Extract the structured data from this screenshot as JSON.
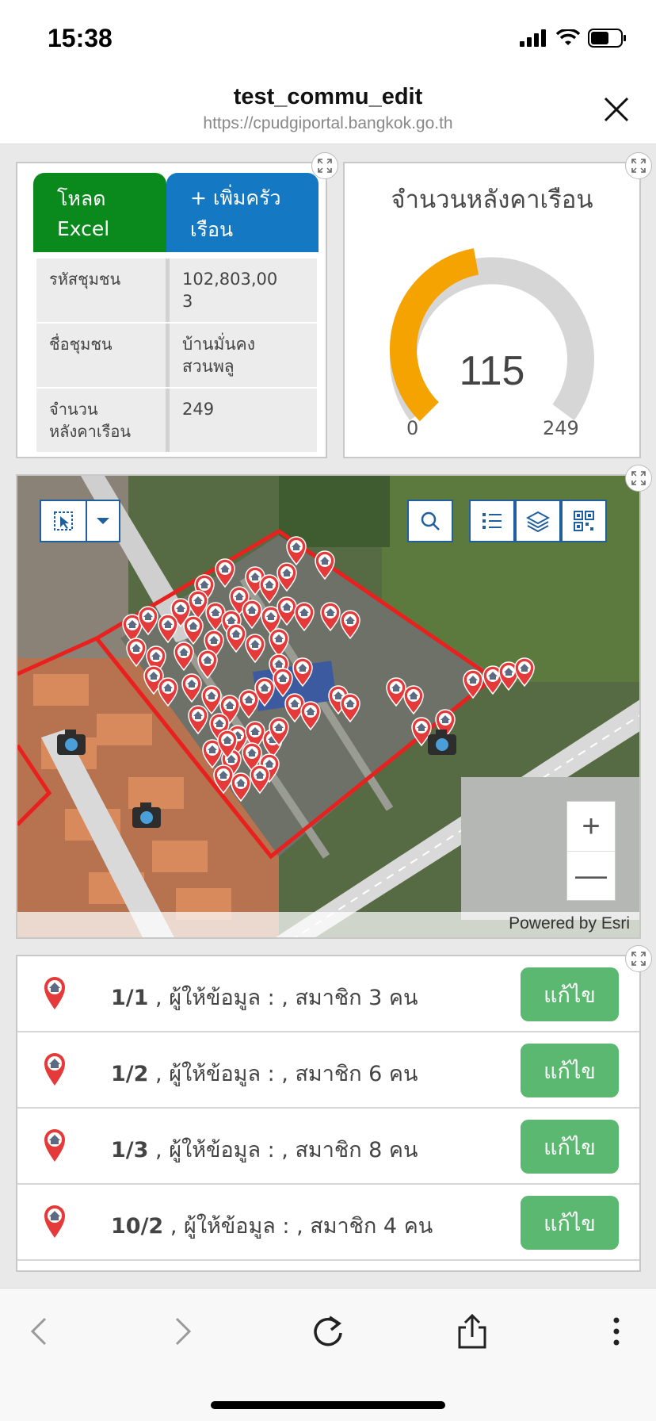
{
  "status_bar": {
    "time": "15:38"
  },
  "browser": {
    "title": "test_commu_edit",
    "url": "https://cpudgiportal.bangkok.go.th"
  },
  "info_card": {
    "excel_button": {
      "line1": "โหลด",
      "line2": "Excel"
    },
    "add_button": {
      "line1": "+ เพิ่มครัว",
      "line2": "เรือน"
    },
    "rows": [
      {
        "key": "รหัสชุมชน",
        "value": "102,803,00\n3"
      },
      {
        "key": "ชื่อชุมชน",
        "value": "บ้านมั่นคง\nสวนพลู"
      },
      {
        "key": "จำนวน\nหลังคาเรือน",
        "value": "249"
      }
    ]
  },
  "gauge": {
    "title": "จำนวนหลังคาเรือน",
    "value": "115",
    "min": "0",
    "max": "249",
    "fill_color": "#f5a300",
    "track_color": "#d6d6d6"
  },
  "map": {
    "attribution": "Powered by Esri",
    "zoom_in": "+",
    "zoom_out": "—",
    "boundary_color": "#e8211f",
    "marker_color": "#e53a3a"
  },
  "household_list": {
    "items": [
      {
        "id": "1/1",
        "detail": ", ผู้ให้ข้อมูล : , สมาชิก 3 คน",
        "action": "แก้ไข"
      },
      {
        "id": "1/2",
        "detail": ", ผู้ให้ข้อมูล : , สมาชิก 6 คน",
        "action": "แก้ไข"
      },
      {
        "id": "1/3",
        "detail": ", ผู้ให้ข้อมูล : , สมาชิก 8 คน",
        "action": "แก้ไข"
      },
      {
        "id": "10/2",
        "detail": ", ผู้ให้ข้อมูล : , สมาชิก 4 คน",
        "action": "แก้ไข"
      }
    ],
    "edit_color": "#5ab870"
  }
}
